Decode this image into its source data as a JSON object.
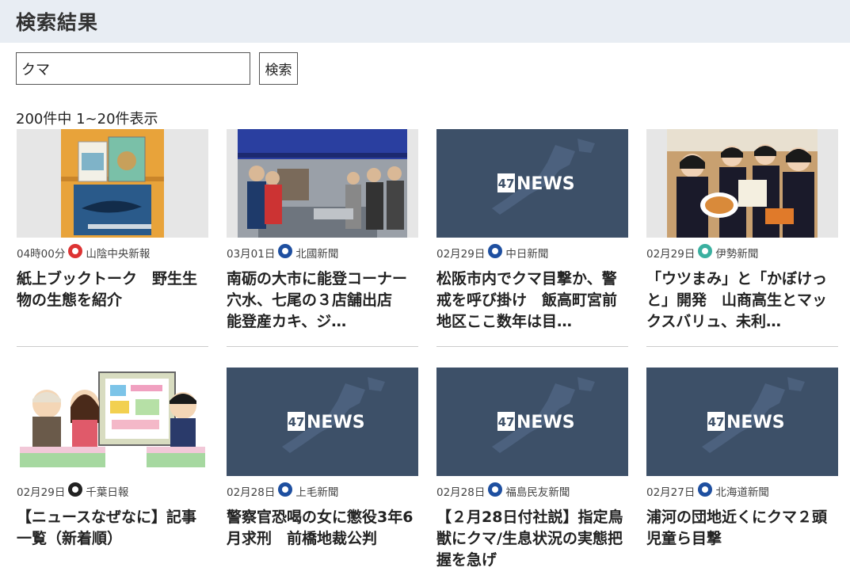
{
  "header": {
    "title": "検索結果"
  },
  "search": {
    "value": "クマ",
    "button_label": "検索"
  },
  "result_count": "200件中 1~20件表示",
  "colors": {
    "header_bg": "#e8edf3",
    "news47_bg": "#3d5068"
  },
  "cards": [
    {
      "date": "04時00分",
      "source": "山陰中央新報",
      "title": "紙上ブックトーク　野生生物の生態を紹介",
      "thumb": "books"
    },
    {
      "date": "03月01日",
      "source": "北國新聞",
      "title": "南砺の大市に能登コーナー　穴水、七尾の３店舗出店　能登産カキ、ジ…",
      "thumb": "market"
    },
    {
      "date": "02月29日",
      "source": "中日新聞",
      "title": "松阪市内でクマ目撃か、警戒を呼び掛け　飯高町宮前地区ここ数年は目…",
      "thumb": "news47",
      "thumb_label": "47NEWS"
    },
    {
      "date": "02月29日",
      "source": "伊勢新聞",
      "title": "「ウツまみ」と「かぼけっと」開発　山商高生とマックスバリュ、未利…",
      "thumb": "students"
    },
    {
      "date": "02月29日",
      "source": "千葉日報",
      "title": "【ニュースなぜなに】記事一覧（新着順）",
      "thumb": "illust"
    },
    {
      "date": "02月28日",
      "source": "上毛新聞",
      "title": "警察官恐喝の女に懲役3年6月求刑　前橋地裁公判",
      "thumb": "news47",
      "thumb_label": "47NEWS"
    },
    {
      "date": "02月28日",
      "source": "福島民友新聞",
      "title": "【２月28日付社説】指定鳥獣にクマ/生息状況の実態把握を急げ",
      "thumb": "news47",
      "thumb_label": "47NEWS"
    },
    {
      "date": "02月27日",
      "source": "北海道新聞",
      "title": "浦河の団地近くにクマ２頭　児童ら目撃",
      "thumb": "news47",
      "thumb_label": "47NEWS"
    }
  ]
}
